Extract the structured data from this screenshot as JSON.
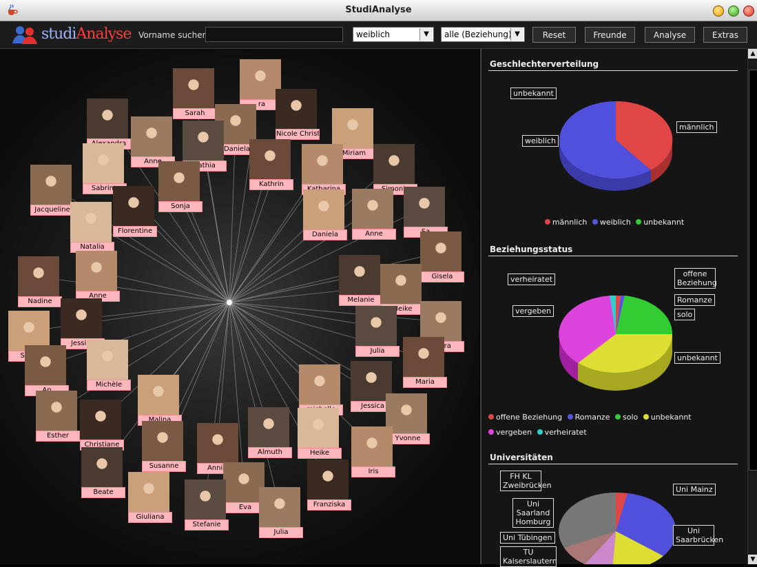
{
  "window": {
    "title": "StudiAnalyse"
  },
  "toolbar": {
    "logo_part1": "studi",
    "logo_part2": "Analyse",
    "search_label": "Vorname suchen:",
    "search_value": "",
    "gender_filter": "weiblich",
    "relationship_filter": "alle (Beziehung)",
    "reset_label": "Reset",
    "friends_label": "Freunde",
    "analysis_label": "Analyse",
    "extras_label": "Extras"
  },
  "graph": {
    "people": [
      {
        "name": "Sarah"
      },
      {
        "name": "ra"
      },
      {
        "name": "Alexandra"
      },
      {
        "name": "Daniela"
      },
      {
        "name": "Nicole Christiane"
      },
      {
        "name": "Miriam"
      },
      {
        "name": "Anne"
      },
      {
        "name": "Kathia"
      },
      {
        "name": "Sabrina"
      },
      {
        "name": "Sonja"
      },
      {
        "name": "Kathrin"
      },
      {
        "name": "Katharina"
      },
      {
        "name": "Simonie"
      },
      {
        "name": "Jacqueline"
      },
      {
        "name": "Florentine"
      },
      {
        "name": "Daniela"
      },
      {
        "name": "Anne"
      },
      {
        "name": "Sa"
      },
      {
        "name": "Natalia"
      },
      {
        "name": "Gisela"
      },
      {
        "name": "Nadine"
      },
      {
        "name": "Anne"
      },
      {
        "name": "Melanie"
      },
      {
        "name": "Meike"
      },
      {
        "name": "Jessika"
      },
      {
        "name": "Sarah"
      },
      {
        "name": "Wera"
      },
      {
        "name": "Julia"
      },
      {
        "name": "Michèle"
      },
      {
        "name": "An"
      },
      {
        "name": "Maria"
      },
      {
        "name": "michelle"
      },
      {
        "name": "Jessica"
      },
      {
        "name": "Esther"
      },
      {
        "name": "Christiane"
      },
      {
        "name": "Malina"
      },
      {
        "name": "Yvonne"
      },
      {
        "name": "Almuth"
      },
      {
        "name": "Heike"
      },
      {
        "name": "Susanne"
      },
      {
        "name": "Annika"
      },
      {
        "name": "Iris"
      },
      {
        "name": "Beate"
      },
      {
        "name": "Eva"
      },
      {
        "name": "Franziska"
      },
      {
        "name": "Giuliana"
      },
      {
        "name": "Julia"
      },
      {
        "name": "Stefanie"
      }
    ]
  },
  "panel": {
    "gender": {
      "title": "Geschlechterverteilung",
      "callouts": [
        "unbekannt",
        "männlich",
        "weiblich"
      ],
      "legend": [
        {
          "label": "männlich",
          "color": "#e04646"
        },
        {
          "label": "weiblich",
          "color": "#5555dd"
        },
        {
          "label": "unbekannt",
          "color": "#33cc33"
        }
      ],
      "shares": {
        "männlich": 0.38,
        "weiblich": 0.62,
        "unbekannt": 0.0
      }
    },
    "relationship": {
      "title": "Beziehungsstatus",
      "callouts": [
        "verheiratet",
        "offene Beziehung",
        "Romanze",
        "vergeben",
        "solo",
        "unbekannt"
      ],
      "legend": [
        {
          "label": "offene Beziehung",
          "color": "#e04646"
        },
        {
          "label": "Romanze",
          "color": "#5555dd"
        },
        {
          "label": "solo",
          "color": "#33cc33"
        },
        {
          "label": "unbekannt",
          "color": "#dddd33"
        },
        {
          "label": "vergeben",
          "color": "#dd44dd"
        },
        {
          "label": "verheiratet",
          "color": "#33cccc"
        }
      ],
      "shares": {
        "offene Beziehung": 0.005,
        "Romanze": 0.01,
        "solo": 0.12,
        "unbekannt": 0.47,
        "vergeben": 0.37,
        "verheiratet": 0.025
      }
    },
    "universities": {
      "title": "Universitäten",
      "callouts": [
        "FH KL Zweibrücken",
        "Uni Mainz",
        "Uni Saarland Homburg",
        "Uni Saarbrücken",
        "Uni Tübingen",
        "TU Kaiserslautern"
      ]
    }
  },
  "scrollbar": {
    "up_label": "▲",
    "down_label": "▼"
  }
}
